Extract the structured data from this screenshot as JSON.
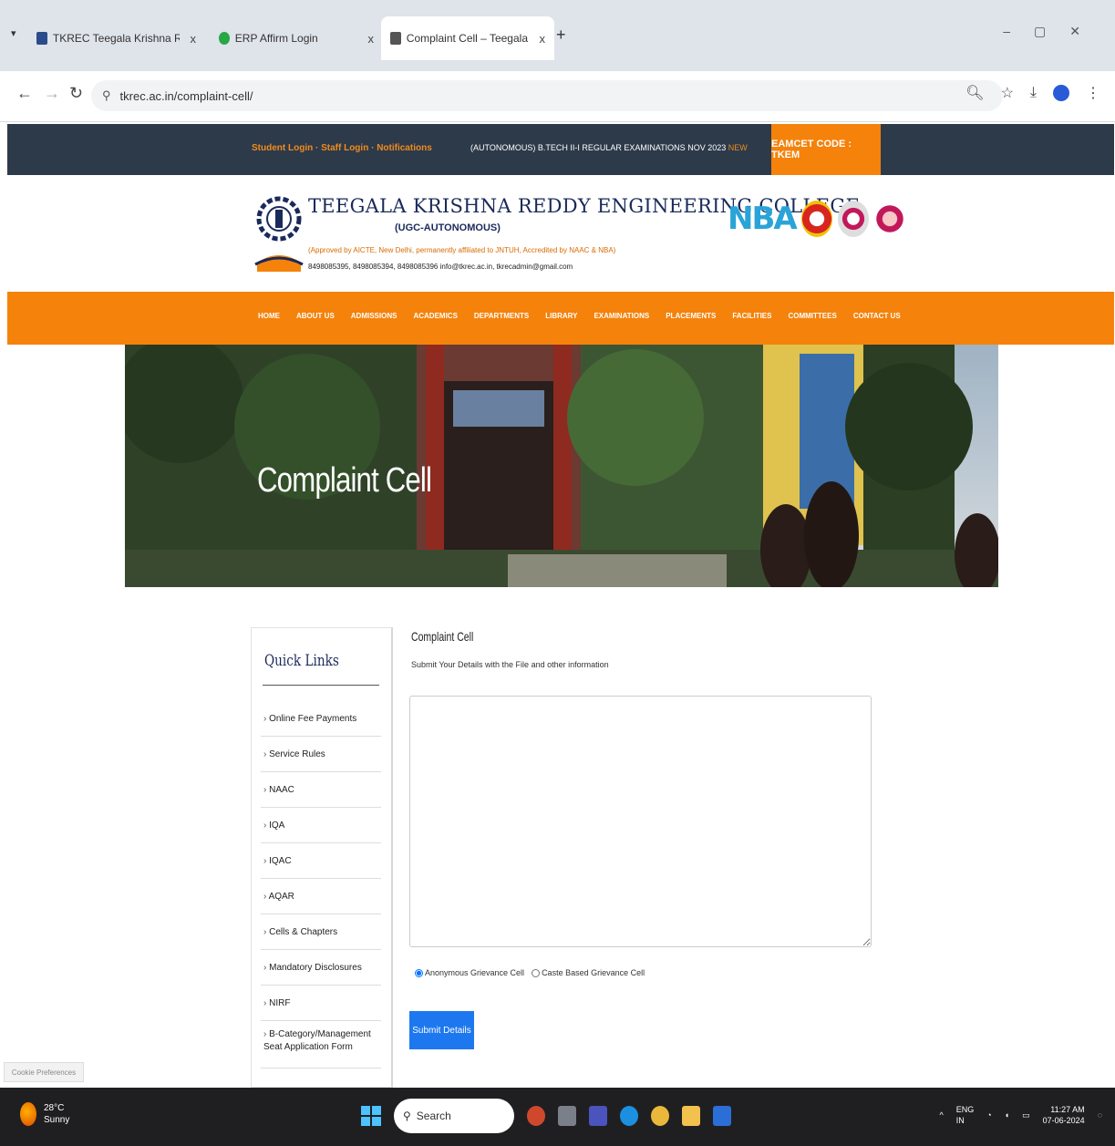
{
  "browser": {
    "tabs": [
      {
        "title": "TKREC Teegala Krishna Reddy I",
        "active": false
      },
      {
        "title": "ERP Affirm Login",
        "active": false
      },
      {
        "title": "Complaint Cell – Teegala Krish",
        "active": true
      }
    ],
    "url": "tkrec.ac.in/complaint-cell/",
    "new_tab": "+",
    "close": "x"
  },
  "site": {
    "top_links": "Student Login · Staff Login · Notifications",
    "marquee": "(AUTONOMOUS) B.TECH II-I REGULAR EXAMINATIONS NOV 2023",
    "marquee_badge": "NEW",
    "eamcet_code": "EAMCET CODE : TKEM",
    "college_name": "TEEGALA KRISHNA REDDY ENGINEERING COLLEGE",
    "ugc": "(UGC-AUTONOMOUS)",
    "approved": "(Approved by AICTE, New Delhi, permanently affiliated to JNTUH, Accredited by NAAC & NBA)",
    "contact": "8498085395, 8498085394, 8498085396    info@tkrec.ac.in, tkrecadmin@gmail.com",
    "accred_nba": "NBA",
    "nav": [
      "HOME",
      "ABOUT US",
      "ADMISSIONS",
      "ACADEMICS",
      "DEPARTMENTS",
      "LIBRARY",
      "EXAMINATIONS",
      "PLACEMENTS",
      "FACILITIES",
      "COMMITTEES",
      "CONTACT US"
    ],
    "hero_title": "Complaint Cell"
  },
  "sidebar": {
    "title": "Quick Links",
    "items": [
      "Online Fee Payments",
      "Service Rules",
      "NAAC",
      "IQA",
      "IQAC",
      "AQAR",
      "Cells & Chapters",
      "Mandatory Disclosures",
      "NIRF",
      "B-Category/Management Seat Application Form"
    ]
  },
  "form": {
    "heading": "Complaint Cell",
    "subheading": "Submit Your Details with the File and other information",
    "textarea_value": "",
    "radio_1": "Anonymous Grievance Cell",
    "radio_2": "Caste Based Grievance Cell",
    "submit_label": "Submit Details"
  },
  "cookie_text": "Cookie Preferences",
  "taskbar": {
    "temp": "28°C",
    "weather": "Sunny",
    "search_placeholder": "Search",
    "lang_1": "ENG",
    "lang_2": "IN",
    "time": "11:27 AM",
    "date": "07-06-2024"
  },
  "colors": {
    "accent_orange": "#f5820b",
    "topbar_dark": "#2d3a4a",
    "submit_blue": "#1d78f0",
    "navy": "#1a2a5a"
  }
}
